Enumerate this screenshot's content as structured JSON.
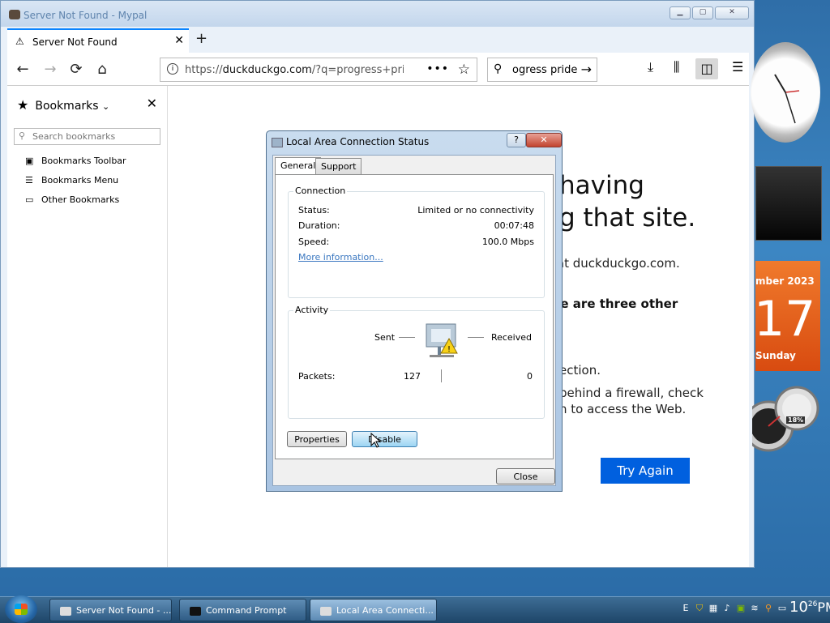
{
  "window": {
    "title": "Server Not Found - Mypal",
    "controls": [
      "minimize",
      "maximize",
      "close"
    ]
  },
  "tabs": [
    {
      "label": "Server Not Found",
      "icon": "warning-icon"
    }
  ],
  "new_tab_label": "+",
  "navbar": {
    "url_prefix": "https://",
    "url_domain": "duckduckgo.com",
    "url_rest": "/?q=progress+pride&",
    "search_value": "ogress pride"
  },
  "sidebar": {
    "title": "Bookmarks",
    "search_placeholder": "Search bookmarks",
    "items": [
      {
        "label": "Bookmarks Toolbar",
        "icon": "bookmark-toolbar-icon"
      },
      {
        "label": "Bookmarks Menu",
        "icon": "bookmark-menu-icon"
      },
      {
        "label": "Other Bookmarks",
        "icon": "folder-icon"
      }
    ]
  },
  "page": {
    "title_line1": "having",
    "title_line2": "g that site.",
    "p1": "r at duckduckgo.com.",
    "p2_bold": "re are three other",
    "p3": "ection.",
    "p4_line1": "behind a firewall, check",
    "p4_line2": "n to access the Web.",
    "try_again": "Try Again"
  },
  "dialog": {
    "title": "Local Area Connection Status",
    "help": "?",
    "tabs": [
      "General",
      "Support"
    ],
    "connection": {
      "label": "Connection",
      "status_label": "Status:",
      "status_value": "Limited or no connectivity",
      "duration_label": "Duration:",
      "duration_value": "00:07:48",
      "speed_label": "Speed:",
      "speed_value": "100.0 Mbps",
      "more_info": "More information..."
    },
    "activity": {
      "label": "Activity",
      "sent_label": "Sent",
      "received_label": "Received",
      "packets_label": "Packets:",
      "packets_sent": "127",
      "packets_received": "0"
    },
    "properties_button": "Properties",
    "disable_button": "Disable",
    "close_button": "Close"
  },
  "taskbar": {
    "items": [
      {
        "label": "Server Not Found - ...",
        "active": false
      },
      {
        "label": "Command Prompt",
        "active": false
      },
      {
        "label": "Local Area Connecti...",
        "active": true
      }
    ],
    "time_hour": "10",
    "time_min": "26",
    "time_ampm": "PM",
    "tray_lang": "E"
  },
  "gadgets": {
    "calendar_month": "mber 2023",
    "calendar_day": "17",
    "calendar_weekday": "Sunday",
    "meter_percent": "18%"
  }
}
